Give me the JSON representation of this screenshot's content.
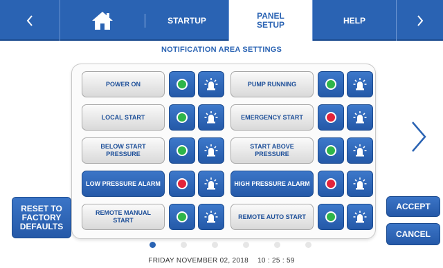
{
  "nav": {
    "home_icon": "home-icon",
    "startup_label": "STARTUP",
    "panel_setup_label_line1": "PANEL",
    "panel_setup_label_line2": "SETUP",
    "help_label": "HELP"
  },
  "title": "NOTIFICATION AREA SETTINGS",
  "settings": {
    "left": [
      {
        "label": "POWER ON",
        "status": "green"
      },
      {
        "label": "LOCAL START",
        "status": "green"
      },
      {
        "label": "BELOW START PRESSURE",
        "status": "green"
      },
      {
        "label": "LOW PRESSURE ALARM",
        "status": "red",
        "selected": true
      },
      {
        "label": "REMOTE MANUAL START",
        "status": "green"
      }
    ],
    "right": [
      {
        "label": "PUMP RUNNING",
        "status": "green"
      },
      {
        "label": "EMERGENCY START",
        "status": "red"
      },
      {
        "label": "START ABOVE PRESSURE",
        "status": "green"
      },
      {
        "label": "HIGH PRESSURE ALARM",
        "status": "red",
        "selected": true
      },
      {
        "label": "REMOTE AUTO START",
        "status": "green"
      }
    ]
  },
  "buttons": {
    "reset_line1": "RESET TO",
    "reset_line2": "FACTORY",
    "reset_line3": "DEFAULTS",
    "accept": "ACCEPT",
    "cancel": "CANCEL"
  },
  "pager": {
    "pages": 6,
    "current": 1
  },
  "footer": {
    "date": "FRIDAY NOVEMBER 02, 2018",
    "time": "10 : 25 : 59"
  },
  "colors": {
    "accent": "#2a63b3",
    "status_green": "#2fb54a",
    "status_red": "#e3243b"
  }
}
